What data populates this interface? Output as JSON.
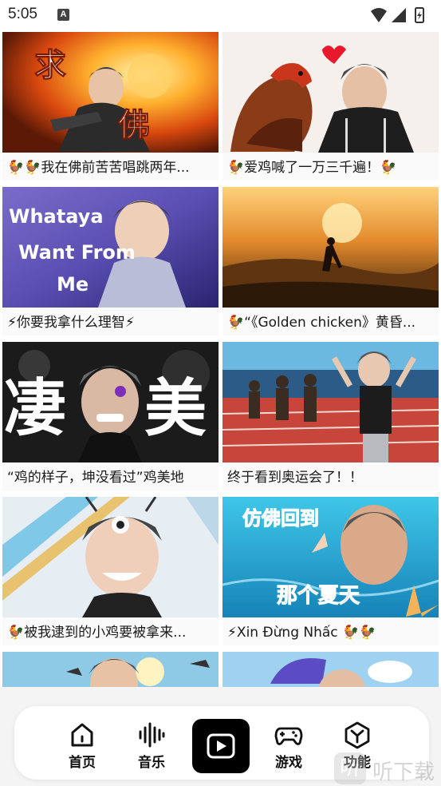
{
  "status_bar": {
    "time": "5:05",
    "notification_badge": "A"
  },
  "videos": [
    {
      "title": "🐓🐓我在佛前苦苦唱跳两年...",
      "overlay_text": "求佛"
    },
    {
      "title": "🐓爱鸡喊了一万三千遍！🐓",
      "overlay_text": ""
    },
    {
      "title": "⚡你要我拿什么理智⚡",
      "overlay_text": "Whataya Want From Me"
    },
    {
      "title": "🐓“《Golden chicken》黄昏...",
      "overlay_text": ""
    },
    {
      "title": "“鸡的样子，坤没看过”鸡美地",
      "overlay_text": "凄美"
    },
    {
      "title": "终于看到奥运会了！！",
      "overlay_text": ""
    },
    {
      "title": "🐓被我逮到的小鸡要被拿来...",
      "overlay_text": ""
    },
    {
      "title": "⚡Xin Đừng Nhấc 🐓🐓",
      "overlay_text": "仿佛回到 那个夏天"
    },
    {
      "title": "",
      "overlay_text": ""
    },
    {
      "title": "",
      "overlay_text": ""
    }
  ],
  "nav": {
    "home": {
      "label": "首页",
      "icon": "home-icon"
    },
    "music": {
      "label": "音乐",
      "icon": "waveform-icon"
    },
    "video": {
      "label": "",
      "icon": "play-icon"
    },
    "games": {
      "label": "游戏",
      "icon": "gamepad-icon"
    },
    "features": {
      "label": "功能",
      "icon": "cube-icon"
    }
  },
  "watermark": {
    "badge": "听",
    "text": "听下载"
  },
  "colors": {
    "nav_play_bg": "#000000",
    "bottom_bg": "#f4f4f4"
  }
}
